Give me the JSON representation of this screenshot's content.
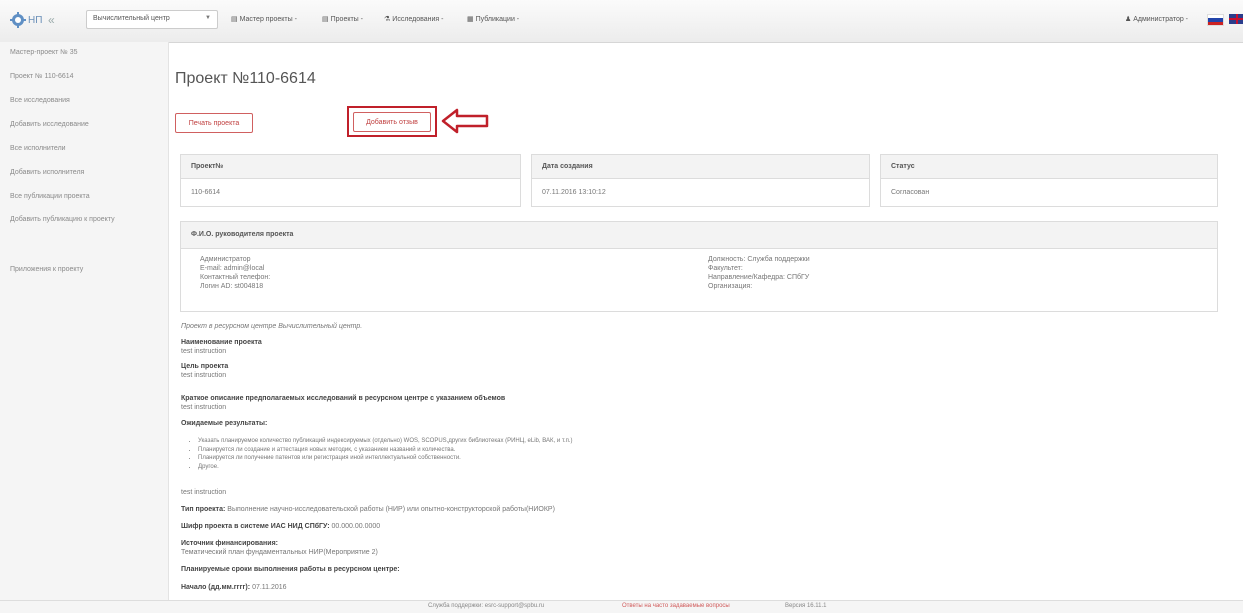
{
  "navbar": {
    "brand": "НП",
    "collapse_icon": "«",
    "center_select": "Вычислительный центр",
    "menus": [
      {
        "icon": "list-icon",
        "label": "Мастер проекты -"
      },
      {
        "icon": "list-icon",
        "label": "Проекты -"
      },
      {
        "icon": "flask-icon",
        "label": "Исследования -"
      },
      {
        "icon": "book-icon",
        "label": "Публикации -"
      }
    ],
    "user": "Администратор -"
  },
  "sidebar": {
    "items": [
      "Мастер-проект № 35",
      "Проект № 110-6614",
      "Все исследования",
      "Добавить исследование",
      "Все исполнители",
      "Добавить исполнителя",
      "Все публикации проекта",
      "Добавить публикацию к проекту",
      "Приложения к проекту"
    ]
  },
  "page": {
    "title": "Проект №110-6614",
    "print_button": "Печать проекта",
    "review_button": "Добавить отзыв"
  },
  "summary": {
    "project_no_head": "Проект№",
    "project_no": "110-6614",
    "created_head": "Дата создания",
    "created": "07.11.2016 13:10:12",
    "status_head": "Статус",
    "status": "Согласован"
  },
  "manager": {
    "head": "Ф.И.О. руководителя проекта",
    "name": "Администратор",
    "email": "E-mail: admin@local",
    "phone": "Контактный телефон:",
    "login": "Логин AD: st004818",
    "position": "Должность: Служба поддержки",
    "faculty": "Факультет:",
    "department": "Направление/Кафедра: СПбГУ",
    "organization": "Организация:"
  },
  "details": {
    "center_note": "Проект в ресурсном центре Вычислительный центр.",
    "name_label": "Наименование проекта",
    "name_value": "test instruction",
    "goal_label": "Цель проекта",
    "goal_value": "test instruction",
    "desc_label": "Краткое описание предполагаемых исследований в ресурсном центре с указанием объемов",
    "desc_value": "test instruction",
    "results_label": "Ожидаемые результаты:",
    "results": [
      "Указать планируемое количество публикаций индексируемых (отдельно) WOS, SCOPUS,других библиотеках (РИНЦ, eLib, ВАК, и т.п.)",
      "Планируется ли создание и аттестация новых методик, с указанием названий и количества.",
      "Планируется ли получение патентов или регистрация иной интеллектуальной собственности.",
      "Другое."
    ],
    "results_value": "test instruction",
    "type_label": "Тип проекта:",
    "type_value": "Выполнение научно-исследовательской работы (НИР) или опытно-конструкторской работы(НИОКР)",
    "cipher_label": "Шифр проекта в системе ИАС НИД СПбГУ:",
    "cipher_value": "00.000.00.0000",
    "funding_label": "Источник финансирования:",
    "funding_value": "Тематический план фундаментальных НИР(Мероприятие 2)",
    "terms_label": "Планируемые сроки выполнения работы в ресурсном центре:",
    "start_label": "Начало (дд.мм.гггг):",
    "start_value": "07.11.2016"
  },
  "footer": {
    "support": "Служба поддержки: esrc-support@spbu.ru",
    "faq": "Ответы на часто задаваемые вопросы",
    "version": "Версия 16.11.1"
  },
  "colors": {
    "accent_red": "#c0202a",
    "brand_blue": "#6a8fb8"
  }
}
